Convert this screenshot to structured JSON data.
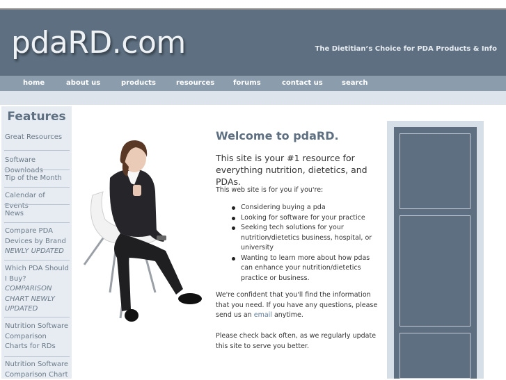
{
  "header": {
    "logo": "pdaRD.com",
    "tagline": "The Dietitian’s Choice for PDA Products & Info"
  },
  "nav": {
    "items": [
      "home",
      "about us",
      "products",
      "resources",
      "forums",
      "contact us",
      "search"
    ]
  },
  "sidebar": {
    "title": "Features",
    "items": [
      {
        "label": "Great Resources"
      },
      {
        "label": "Software Downloads"
      },
      {
        "label": "Tip of the Month"
      },
      {
        "label": "Calendar of Events"
      },
      {
        "label": "News"
      },
      {
        "label": "Compare PDA Devices by Brand",
        "badge": "NEWLY UPDATED"
      },
      {
        "label": "Which PDA Should I Buy?",
        "badge": "COMPARISON CHART NEWLY UPDATED"
      },
      {
        "label": "Nutrition Software Comparison Charts for RDs"
      },
      {
        "label": "Nutrition Software Comparison Chart"
      }
    ]
  },
  "main": {
    "heading": "Welcome to pdaRD.",
    "intro": "This site is your #1 resource for everything nutrition, dietetics, and PDAs.",
    "lead": "This web site is for you if you're:",
    "bullets": [
      "Considering buying a pda",
      "Looking for software for your practice",
      "Seeking tech solutions for your nutrition/dietetics business, hospital, or university",
      "Wanting to learn more about how pdas can enhance your nutrition/dietetics practice or business."
    ],
    "confident_text": "We're confident that you'll find the information that you need. If you have any questions, please send us an",
    "email_link": "email",
    "confident_suffix": " anytime.",
    "check_back": "Please check back often, as we regularly update this site to serve you better."
  },
  "colors": {
    "header_bg": "#5d6f80",
    "nav_bg": "#8b9cad",
    "subbar_bg": "#dde4ec",
    "sidebar_bg": "#e6ecf2",
    "accent_text": "#5d6f80"
  }
}
